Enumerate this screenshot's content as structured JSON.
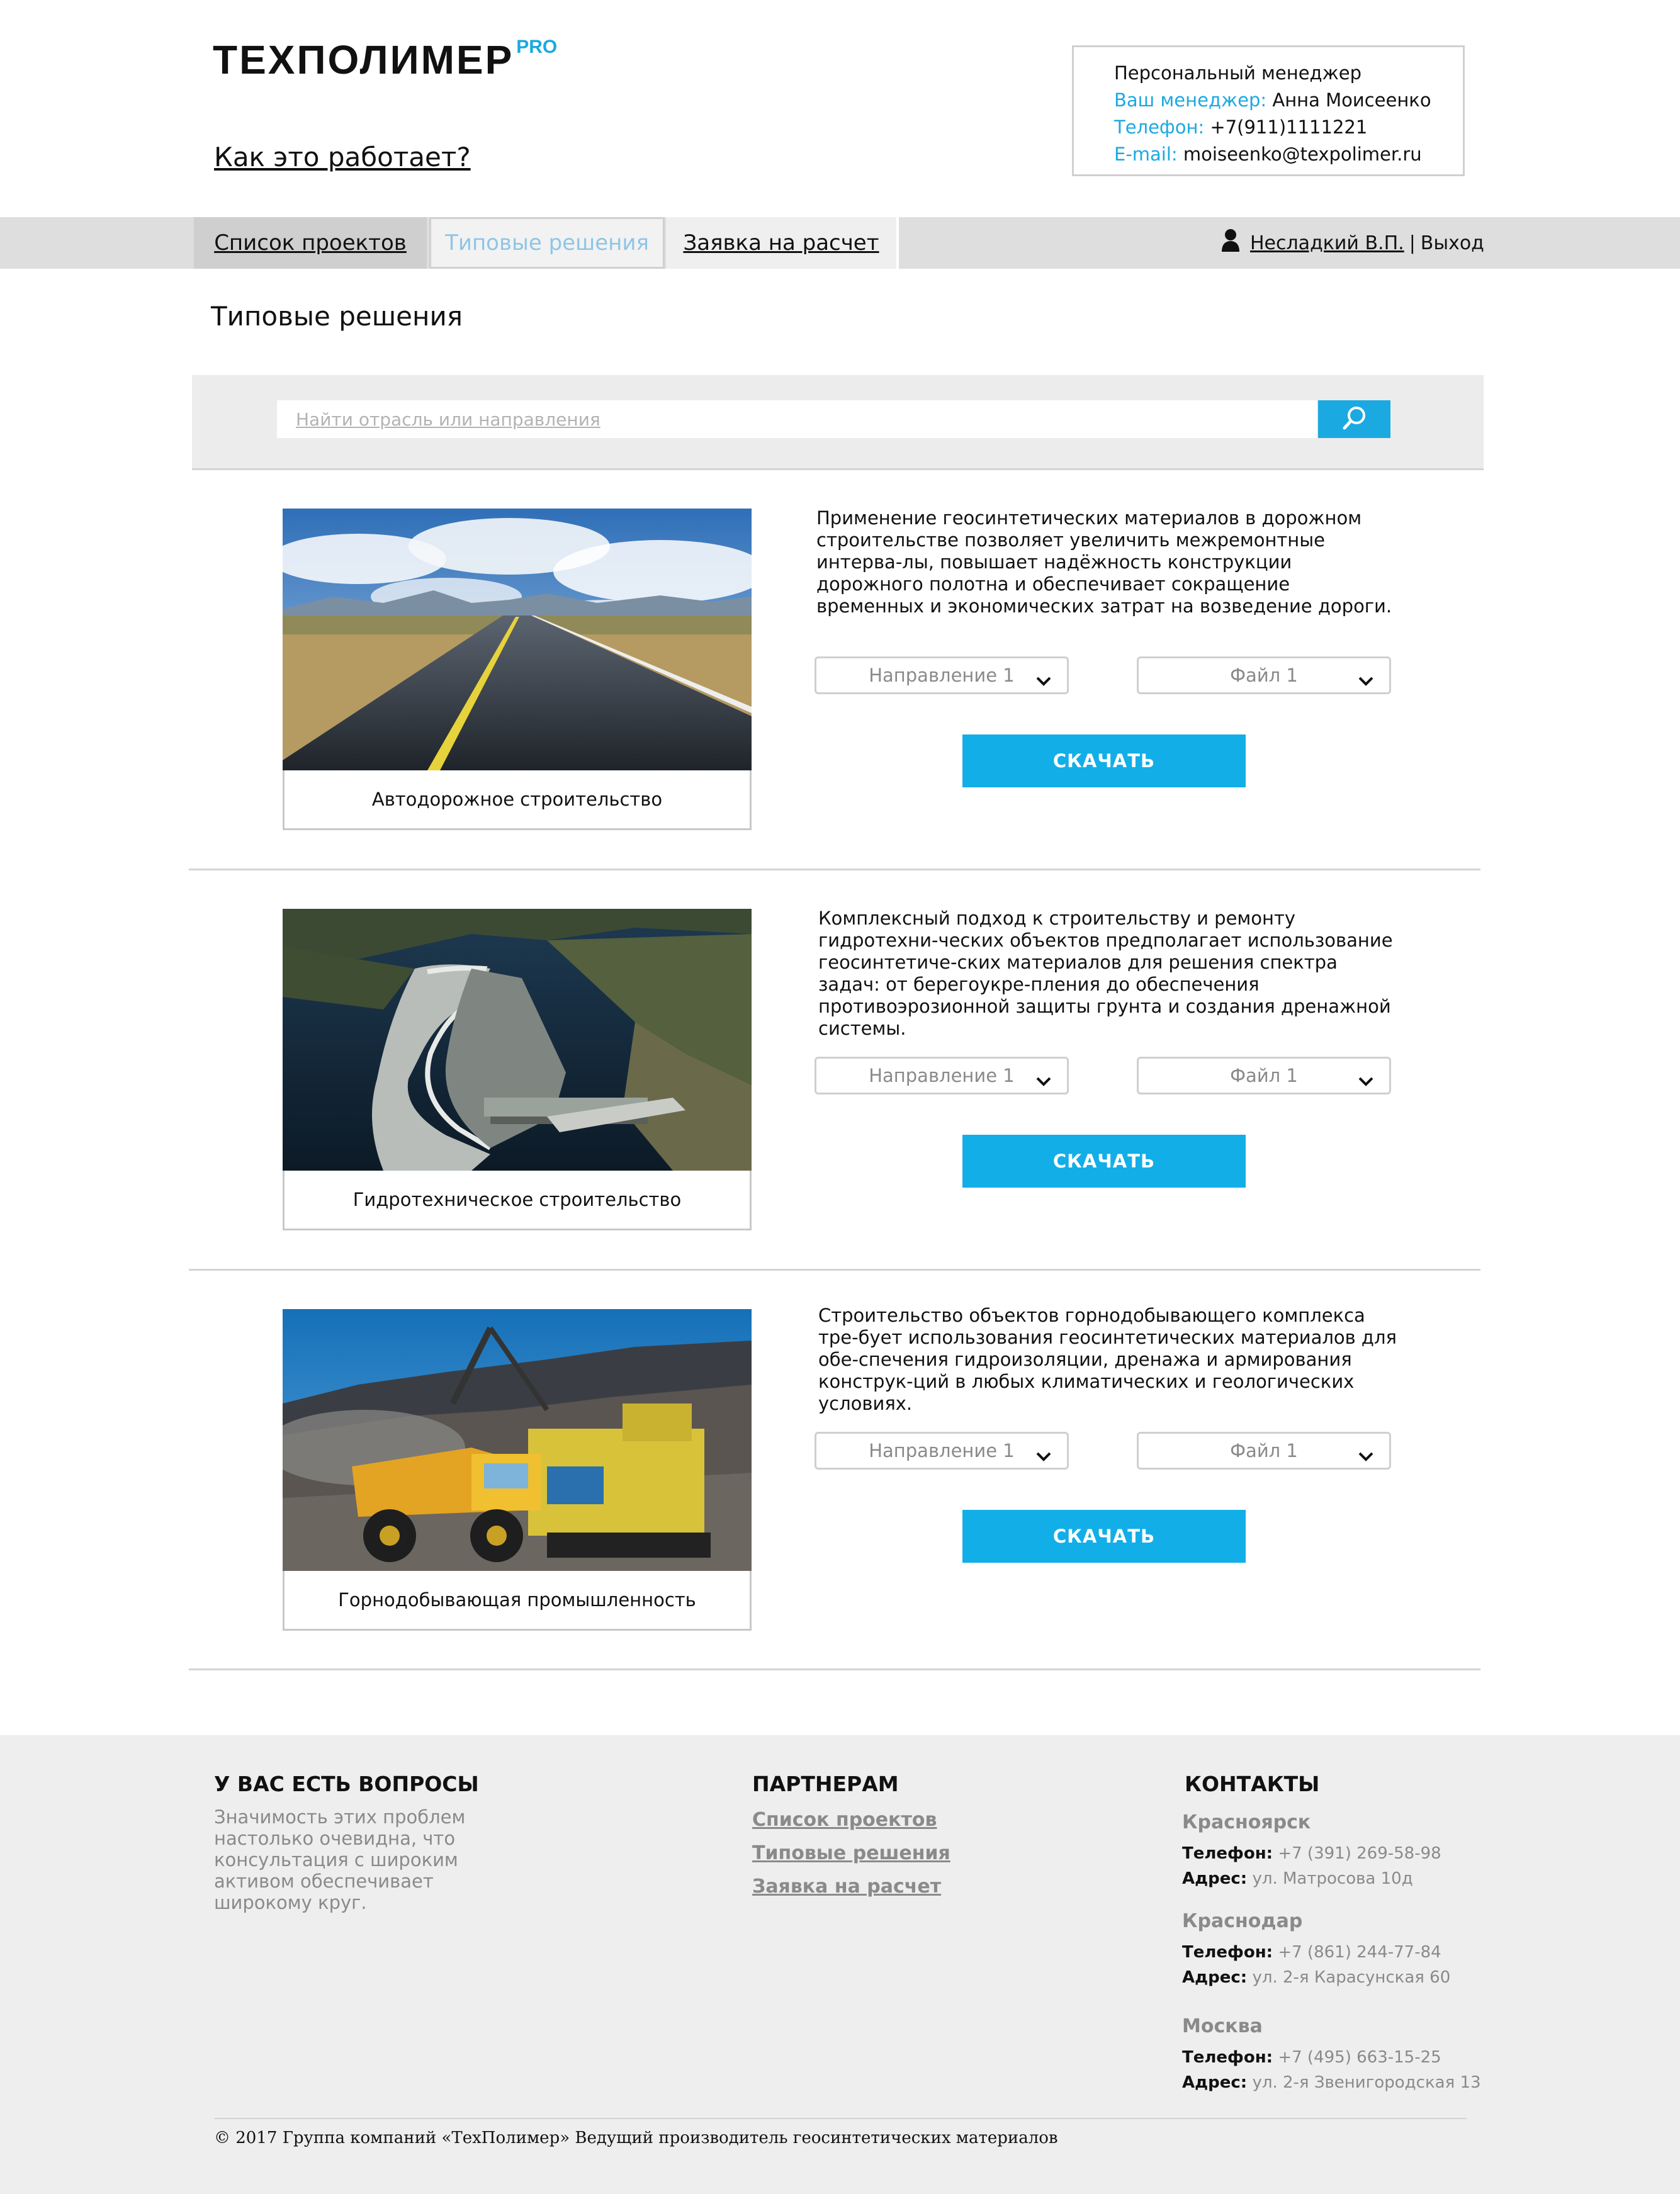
{
  "header": {
    "logo_text": "ТЕХПОЛИМЕР",
    "logo_badge": "PRO",
    "how_it_works": "Как это работает?"
  },
  "manager": {
    "title": "Персональный менеджер",
    "name_label": "Ваш менеджер:",
    "name_value": "Анна Моисеенко",
    "phone_label": "Телефон:",
    "phone_value": "+7(911)1111221",
    "email_label": "E-mail:",
    "email_value": "moiseenko@texpolimer.ru"
  },
  "nav": {
    "tabs": [
      {
        "label": "Список проектов"
      },
      {
        "label": "Типовые решения"
      },
      {
        "label": "Заявка на расчет"
      }
    ],
    "user_name": "Несладкий В.П.",
    "separator": "|",
    "logout": "Выход"
  },
  "page_title": "Типовые решения",
  "search": {
    "placeholder": "Найти отрасль или направления"
  },
  "solutions": [
    {
      "caption": "Автодорожное строительство",
      "description": "Применение геосинтетических материалов в дорожном строительстве позволяет увеличить межремонтные интерва-лы, повышает надёжность конструкции дорожного полотна и обеспечивает сокращение временных и экономических затрат на возведение дороги.",
      "direction": "Направление 1",
      "file": "Файл 1",
      "button": "СКАЧАТЬ"
    },
    {
      "caption": "Гидротехническое строительство",
      "description": "Комплексный подход к строительству и ремонту гидротехни-ческих объектов предполагает использование геосинтетиче-ских материалов для решения спектра задач: от берегоукре-пления до обеспечения противоэрозионной защиты грунта и создания дренажной системы.",
      "direction": "Направление 1",
      "file": "Файл 1",
      "button": "СКАЧАТЬ"
    },
    {
      "caption": "Горнодобывающая промышленность",
      "description": "Строительство объектов горнодобывающего комплекса тре-бует использования геосинтетических материалов для обе-спечения гидроизоляции, дренажа и армирования конструк-ций в любых климатических и геологических условиях.",
      "direction": "Направление 1",
      "file": "Файл 1",
      "button": "СКАЧАТЬ"
    }
  ],
  "footer": {
    "questions": {
      "title": "У ВАС ЕСТЬ ВОПРОСЫ",
      "text": "Значимость этих проблем настолько очевидна, что консультация с широким активом обеспечивает широкому круг."
    },
    "partners": {
      "title": "ПАРТНЕРАМ",
      "links": [
        "Список проектов",
        "Типовые решения",
        "Заявка на расчет"
      ]
    },
    "contacts": {
      "title": "КОНТАКТЫ",
      "phone_label": "Телефон:",
      "address_label": "Адрес:",
      "cities": [
        {
          "city": "Красноярск",
          "phone": "+7 (391) 269-58-98",
          "address": "ул. Матросова 10д"
        },
        {
          "city": "Краснодар",
          "phone": "+7 (861) 244-77-84",
          "address": "ул. 2-я Карасунская 60"
        },
        {
          "city": "Москва",
          "phone": "+7 (495) 663-15-25",
          "address": "ул. 2-я Звенигородская 13"
        }
      ]
    },
    "copyright": "© 2017 Группа компаний «ТехПолимер» Ведущий производитель геосинтетических материалов"
  },
  "colors": {
    "accent": "#1ba9e1",
    "button": "#12aee8",
    "nav_bg": "#dedede",
    "footer_bg": "#eeeeee"
  }
}
